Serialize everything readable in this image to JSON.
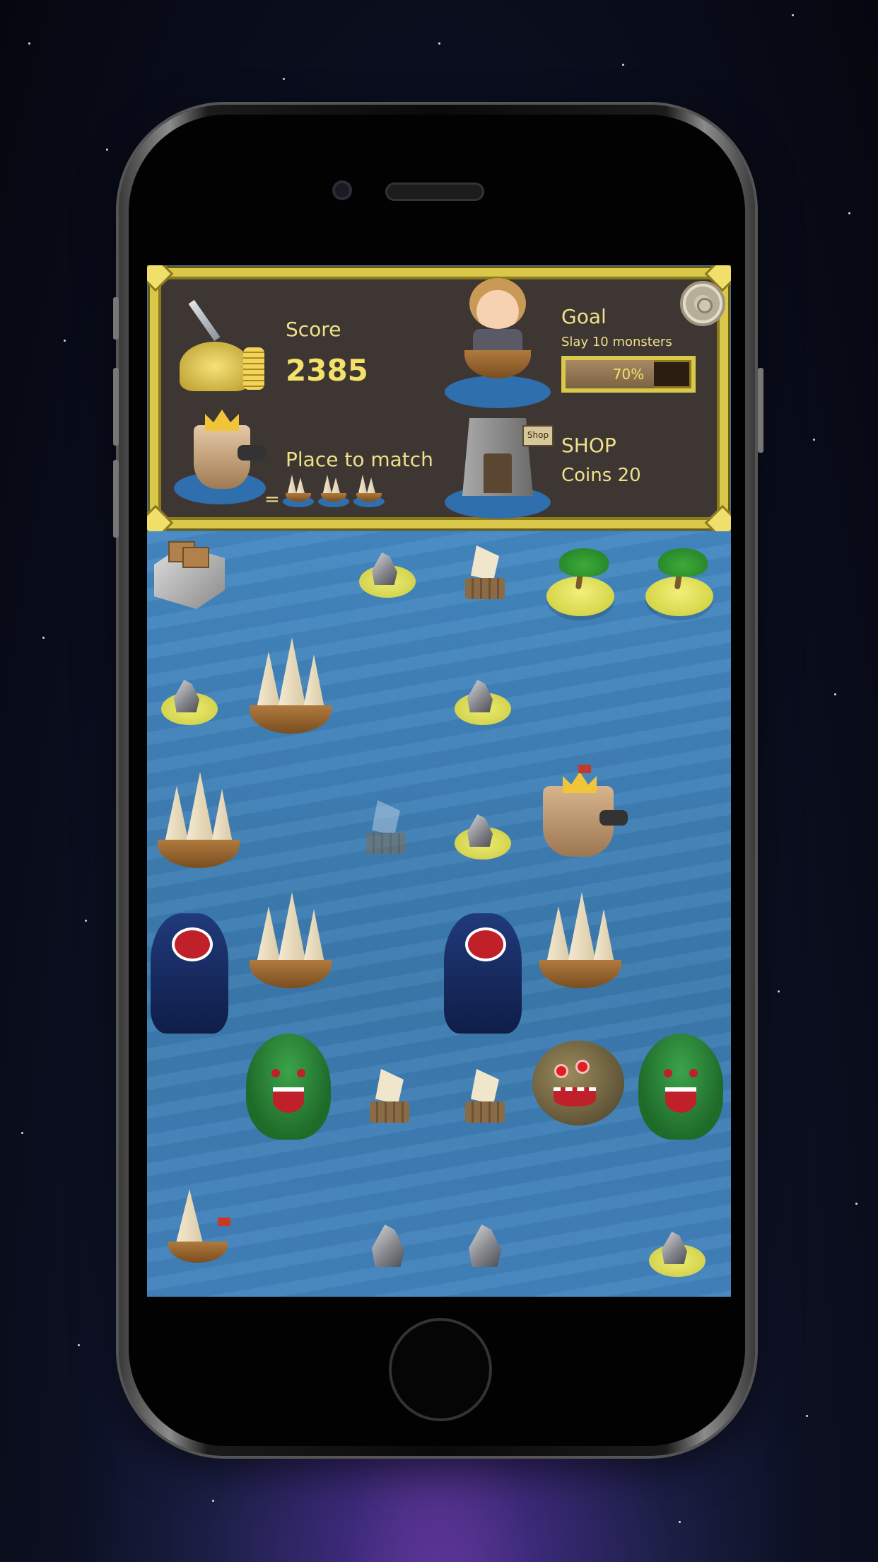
{
  "hud": {
    "score_label": "Score",
    "score_value": "2385",
    "place_label": "Place to match",
    "equals": "=",
    "goal_label": "Goal",
    "goal_text": "Slay 10 monsters",
    "goal_progress_text": "70%",
    "goal_progress": 0.7,
    "shop_label": "SHOP",
    "coins_text": "Coins 20",
    "shop_sign": "Shop"
  },
  "icons": {
    "settings": "gear-icon",
    "treasure": "treasure-icon",
    "hero": "hero-avatar-icon",
    "shop": "shop-tower-icon",
    "next_piece": "castle-ship-icon"
  },
  "board": {
    "rows": [
      [
        "fort",
        "empty",
        "rock-island",
        "raft",
        "palm-island",
        "palm-island"
      ],
      [
        "rock-island",
        "galleon",
        "empty",
        "rock-island",
        "empty",
        "empty"
      ],
      [
        "galleon",
        "empty",
        "ghost-raft",
        "rock-island",
        "castle-ship",
        "empty"
      ],
      [
        "sea-serpent",
        "galleon",
        "empty",
        "sea-serpent",
        "galleon",
        "empty"
      ],
      [
        "empty",
        "kraken",
        "raft",
        "raft",
        "piranha",
        "kraken"
      ],
      [
        "sailboat",
        "empty",
        "rock",
        "rock",
        "empty",
        "rock-island"
      ]
    ]
  },
  "colors": {
    "hud_border": "#d9c84a",
    "hud_bg": "#3d3633",
    "sea": "#3b7aae",
    "text_gold": "#efe08a"
  }
}
